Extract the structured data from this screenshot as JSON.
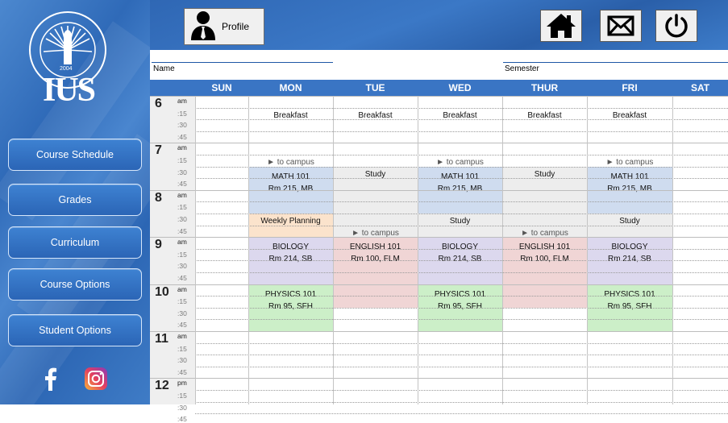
{
  "sidebar": {
    "logo_text": "IUS",
    "logo_ring_text": "INTERNATIONAL UNIVERSITY OF SARAJEVO",
    "logo_year": "2004",
    "buttons": [
      {
        "label": "Course Schedule"
      },
      {
        "label": "Grades"
      },
      {
        "label": "Curriculum"
      },
      {
        "label": "Course Options"
      },
      {
        "label": "Student Options"
      }
    ],
    "social": [
      "facebook-icon",
      "instagram-icon"
    ]
  },
  "topbar": {
    "profile_label": "Profile",
    "icons": [
      "home-icon",
      "mail-icon",
      "power-icon"
    ]
  },
  "info": {
    "name_label": "Name",
    "semester_label": "Semester"
  },
  "schedule": {
    "days": [
      "SUN",
      "MON",
      "TUE",
      "WED",
      "THUR",
      "FRI",
      "SAT"
    ],
    "hours": [
      {
        "num": "6",
        "suffix": "am"
      },
      {
        "num": "7",
        "suffix": "am"
      },
      {
        "num": "8",
        "suffix": "am"
      },
      {
        "num": "9",
        "suffix": "am"
      },
      {
        "num": "10",
        "suffix": "am"
      },
      {
        "num": "11",
        "suffix": "am"
      },
      {
        "num": "12",
        "suffix": "pm"
      }
    ],
    "quarters": [
      ":15",
      ":30",
      ":45"
    ],
    "colors": {
      "header": "#3a75c4",
      "math": "#cfdcef",
      "study": "#ededed",
      "biology": "#dcd8ee",
      "english": "#f0d5d5",
      "physics": "#ccefc8",
      "planning": "#fbe3cc"
    },
    "events": [
      {
        "day": 1,
        "slot": 1,
        "span": 1,
        "lines": [
          "Breakfast"
        ],
        "color": "none"
      },
      {
        "day": 2,
        "slot": 1,
        "span": 1,
        "lines": [
          "Breakfast"
        ],
        "color": "none"
      },
      {
        "day": 3,
        "slot": 1,
        "span": 1,
        "lines": [
          "Breakfast"
        ],
        "color": "none"
      },
      {
        "day": 4,
        "slot": 1,
        "span": 1,
        "lines": [
          "Breakfast"
        ],
        "color": "none"
      },
      {
        "day": 5,
        "slot": 1,
        "span": 1,
        "lines": [
          "Breakfast"
        ],
        "color": "none"
      },
      {
        "day": 1,
        "slot": 5,
        "span": 1,
        "lines": [
          "► to campus"
        ],
        "color": "none",
        "kind": "campus"
      },
      {
        "day": 3,
        "slot": 5,
        "span": 1,
        "lines": [
          "► to campus"
        ],
        "color": "none",
        "kind": "campus"
      },
      {
        "day": 5,
        "slot": 5,
        "span": 1,
        "lines": [
          "► to campus"
        ],
        "color": "none",
        "kind": "campus"
      },
      {
        "day": 1,
        "slot": 6,
        "span": 4,
        "lines": [
          "",
          "MATH 101",
          "Rm 215, MB"
        ],
        "color": "math"
      },
      {
        "day": 3,
        "slot": 6,
        "span": 4,
        "lines": [
          "",
          "MATH 101",
          "Rm 215, MB"
        ],
        "color": "math"
      },
      {
        "day": 5,
        "slot": 6,
        "span": 4,
        "lines": [
          "",
          "MATH 101",
          "Rm 215, MB"
        ],
        "color": "math"
      },
      {
        "day": 2,
        "slot": 6,
        "span": 6,
        "lines": [
          "Study"
        ],
        "color": "study"
      },
      {
        "day": 4,
        "slot": 6,
        "span": 6,
        "lines": [
          "Study"
        ],
        "color": "study"
      },
      {
        "day": 1,
        "slot": 10,
        "span": 2,
        "lines": [
          "Weekly Planning"
        ],
        "color": "planning"
      },
      {
        "day": 3,
        "slot": 10,
        "span": 2,
        "lines": [
          "Study"
        ],
        "color": "study"
      },
      {
        "day": 5,
        "slot": 10,
        "span": 2,
        "lines": [
          "Study"
        ],
        "color": "study"
      },
      {
        "day": 2,
        "slot": 11,
        "span": 1,
        "lines": [
          "► to campus"
        ],
        "color": "none",
        "kind": "campus"
      },
      {
        "day": 4,
        "slot": 11,
        "span": 1,
        "lines": [
          "► to campus"
        ],
        "color": "none",
        "kind": "campus"
      },
      {
        "day": 1,
        "slot": 12,
        "span": 4,
        "lines": [
          "",
          "BIOLOGY",
          "Rm 214, SB"
        ],
        "color": "biology"
      },
      {
        "day": 3,
        "slot": 12,
        "span": 4,
        "lines": [
          "",
          "BIOLOGY",
          "Rm 214, SB"
        ],
        "color": "biology"
      },
      {
        "day": 5,
        "slot": 12,
        "span": 4,
        "lines": [
          "",
          "BIOLOGY",
          "Rm 214, SB"
        ],
        "color": "biology"
      },
      {
        "day": 2,
        "slot": 12,
        "span": 6,
        "lines": [
          "",
          "ENGLISH 101",
          "Rm 100, FLM"
        ],
        "color": "english"
      },
      {
        "day": 4,
        "slot": 12,
        "span": 6,
        "lines": [
          "",
          "ENGLISH 101",
          "Rm 100, FLM"
        ],
        "color": "english"
      },
      {
        "day": 1,
        "slot": 16,
        "span": 4,
        "lines": [
          "",
          "PHYSICS 101",
          "Rm 95, SFH"
        ],
        "color": "physics"
      },
      {
        "day": 3,
        "slot": 16,
        "span": 4,
        "lines": [
          "",
          "PHYSICS 101",
          "Rm 95, SFH"
        ],
        "color": "physics"
      },
      {
        "day": 5,
        "slot": 16,
        "span": 4,
        "lines": [
          "",
          "PHYSICS 101",
          "Rm 95, SFH"
        ],
        "color": "physics"
      }
    ]
  }
}
